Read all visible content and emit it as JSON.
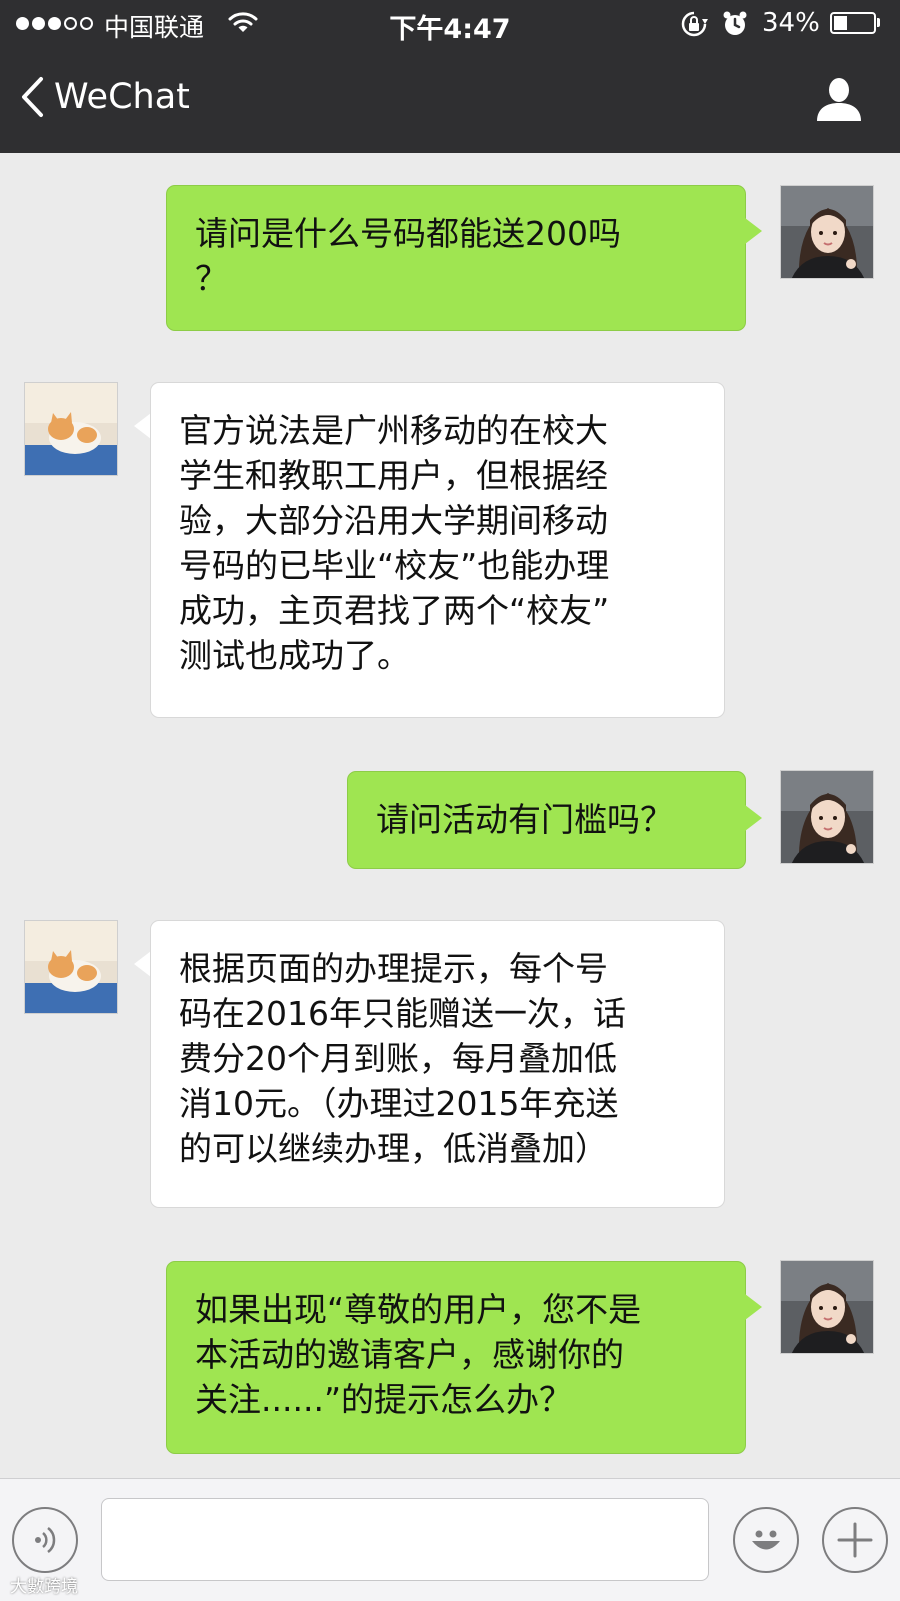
{
  "status_bar": {
    "signal_full": 3,
    "signal_empty": 2,
    "carrier": "中国联通",
    "time": "下午4:47",
    "battery_percent": "34%",
    "battery_level": 0.34,
    "icons": [
      "wifi-icon",
      "rotation-lock-icon",
      "alarm-icon",
      "battery-icon"
    ]
  },
  "nav": {
    "back_label": "WeChat",
    "back_icon": "chevron-left-icon",
    "profile_icon": "person-icon"
  },
  "messages": [
    {
      "direction": "out",
      "text": "请问是什么号码都能送200吗\n？",
      "avatar": "user-avatar"
    },
    {
      "direction": "in",
      "text": "官方说法是广州移动的在校大\n学生和教职工用户，但根据经\n验，大部分沿用大学期间移动\n号码的已毕业“校友”也能办理\n成功，主页君找了两个“校友”\n测试也成功了。",
      "avatar": "cat-avatar"
    },
    {
      "direction": "out",
      "text": "请问活动有门槛吗？",
      "avatar": "user-avatar"
    },
    {
      "direction": "in",
      "text": "根据页面的办理提示，每个号\n码在2016年只能赠送一次，话\n费分20个月到账，每月叠加低\n消10元。（办理过2015年充送\n的可以继续办理，低消叠加）",
      "avatar": "cat-avatar"
    },
    {
      "direction": "out",
      "text": "如果出现“尊敬的用户，您不是\n本活动的邀请客户，感谢你的\n关注......”的提示怎么办？",
      "avatar": "user-avatar"
    }
  ],
  "input_bar": {
    "voice_icon": "voice-icon",
    "emoji_icon": "emoji-icon",
    "plus_icon": "plus-icon",
    "input_value": ""
  },
  "watermark": "大數跨境",
  "colors": {
    "nav_background": "#2f2f31",
    "chat_background": "#ebebeb",
    "outgoing_bubble": "#9fe551",
    "incoming_bubble": "#ffffff"
  }
}
